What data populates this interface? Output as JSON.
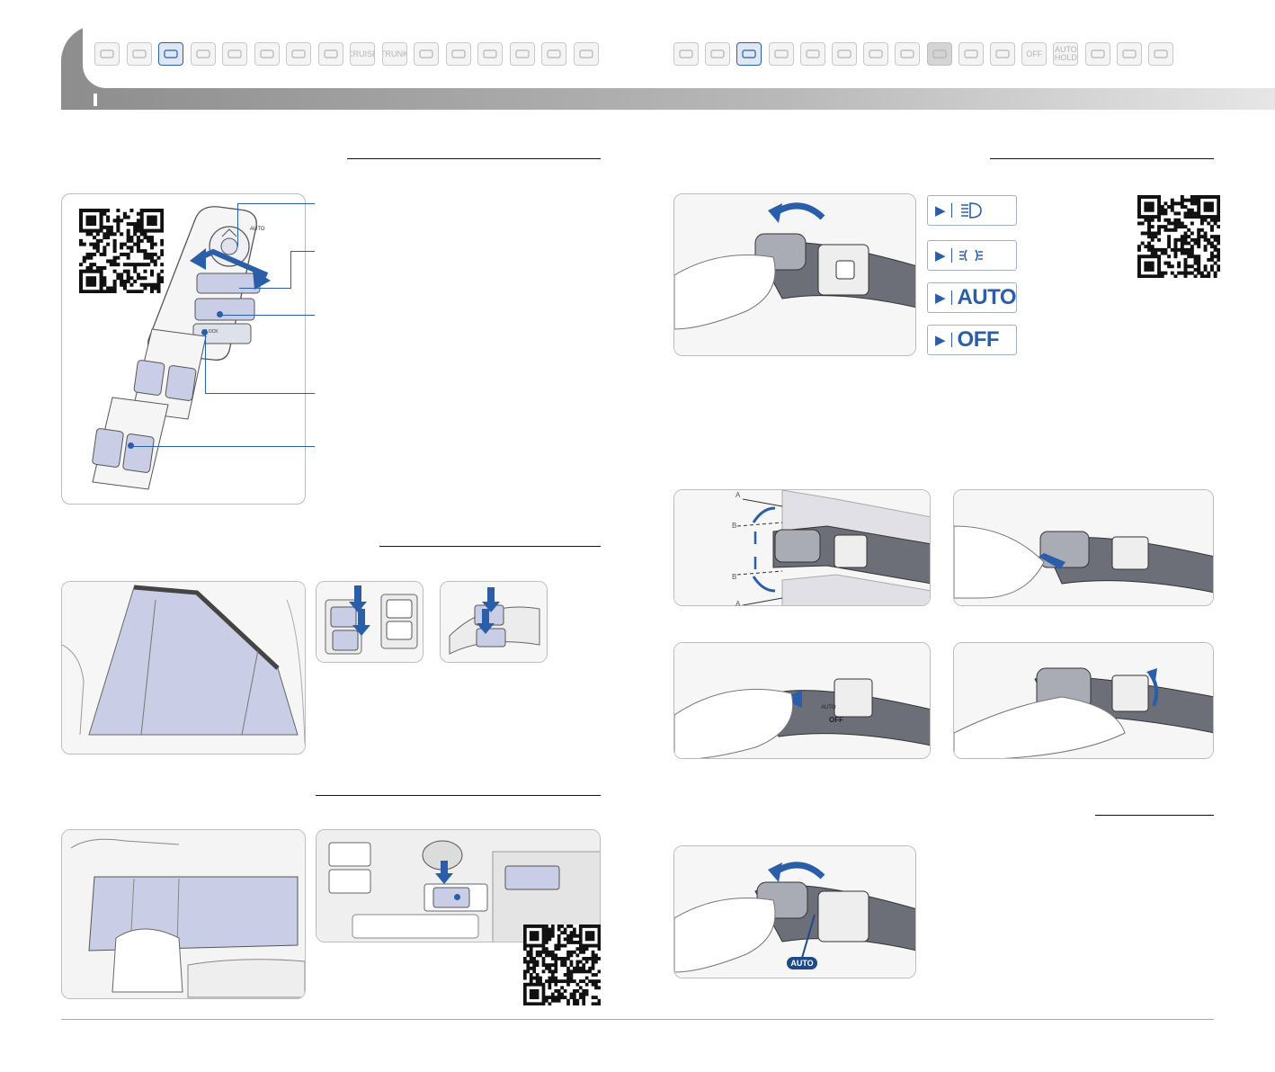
{
  "nav_left": [
    {
      "icon": "wiper-icon",
      "label": "",
      "active": false
    },
    {
      "icon": "mirror-icon",
      "label": "",
      "active": false
    },
    {
      "icon": "window-switch-icon",
      "label": "",
      "active": true
    },
    {
      "icon": "key-icon",
      "label": "",
      "active": false
    },
    {
      "icon": "seat-icon",
      "label": "",
      "active": false
    },
    {
      "icon": "console-icon",
      "label": "",
      "active": false
    },
    {
      "icon": "climate-icon",
      "label": "",
      "active": false
    },
    {
      "icon": "dash-icon",
      "label": "",
      "active": false
    },
    {
      "icon": "cruise-icon",
      "label": "CRUISE",
      "active": false
    },
    {
      "icon": "trunk-icon",
      "label": "TRUNK",
      "active": false
    },
    {
      "icon": "card-icon",
      "label": "",
      "active": false
    },
    {
      "icon": "tpms-icon",
      "label": "",
      "active": false
    },
    {
      "icon": "display-icon",
      "label": "",
      "active": false
    },
    {
      "icon": "info-icon",
      "label": "",
      "active": false
    },
    {
      "icon": "vent-icon",
      "label": "",
      "active": false
    },
    {
      "icon": "bluetooth-icon",
      "label": "",
      "active": false
    }
  ],
  "nav_right": [
    {
      "icon": "phone-icon",
      "label": "",
      "active": false
    },
    {
      "icon": "gauge-icon",
      "label": "",
      "active": false
    },
    {
      "icon": "headlight-stalk-icon",
      "label": "",
      "active": true
    },
    {
      "icon": "wiper-stalk-icon",
      "label": "",
      "active": false
    },
    {
      "icon": "panel-icon",
      "label": "",
      "active": false
    },
    {
      "icon": "console2-icon",
      "label": "",
      "active": false
    },
    {
      "icon": "climate2-icon",
      "label": "",
      "active": false
    },
    {
      "icon": "grid-icon",
      "label": "",
      "active": false
    },
    {
      "icon": "blank-icon",
      "label": "",
      "active": false,
      "dim": true
    },
    {
      "icon": "screen-icon",
      "label": "",
      "active": false
    },
    {
      "icon": "hand-icon",
      "label": "",
      "active": false
    },
    {
      "icon": "traction-off-icon",
      "label": "OFF",
      "active": false
    },
    {
      "icon": "auto-hold-icon",
      "label": "AUTO HOLD",
      "active": false
    },
    {
      "icon": "camera-icon",
      "label": "",
      "active": false
    },
    {
      "icon": "bluetooth-icon",
      "label": "",
      "active": false
    },
    {
      "icon": "bluetooth-icon",
      "label": "",
      "active": false
    }
  ],
  "window_switch": {
    "auto_label": "AUTO",
    "lock_label": "LOCK"
  },
  "headlight_legend": [
    {
      "icon": "high-beam-icon",
      "word": ""
    },
    {
      "icon": "position-lamp-icon",
      "word": ""
    },
    {
      "icon": "",
      "word": "AUTO"
    },
    {
      "icon": "",
      "word": "OFF"
    }
  ],
  "stalk_positions": {
    "a_top": "A",
    "b_top": "B",
    "b_bottom": "B",
    "a_bottom": "A"
  },
  "stalk_labels": {
    "auto": "AUTO",
    "off": "OFF"
  },
  "auto_badge": "AUTO",
  "colors": {
    "accent": "#2a5ea8",
    "highlight": "#c9cde6",
    "header_grey": "#a0a0a0"
  }
}
